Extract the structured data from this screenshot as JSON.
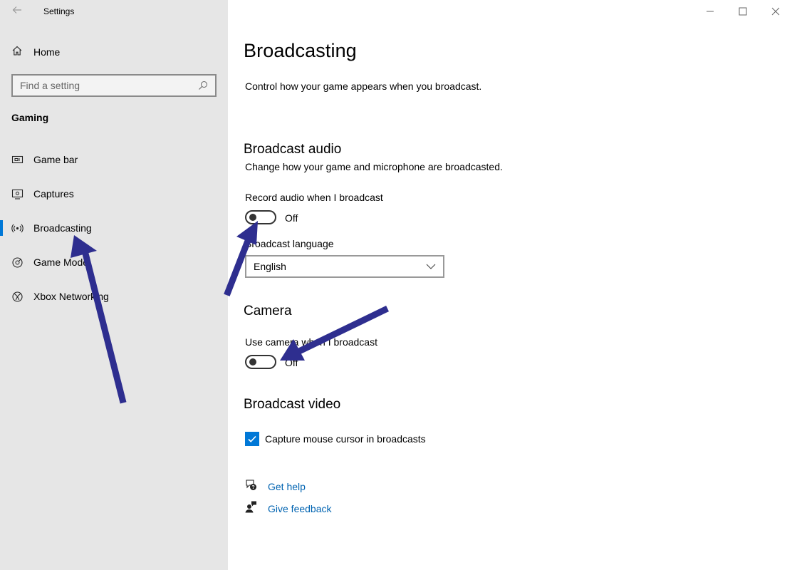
{
  "app": {
    "title": "Settings"
  },
  "sidebar": {
    "home_label": "Home",
    "search_placeholder": "Find a setting",
    "section_title": "Gaming",
    "items": [
      {
        "label": "Game bar",
        "icon": "game-bar-icon"
      },
      {
        "label": "Captures",
        "icon": "captures-icon"
      },
      {
        "label": "Broadcasting",
        "icon": "broadcasting-icon",
        "selected": true
      },
      {
        "label": "Game Mode",
        "icon": "game-mode-icon"
      },
      {
        "label": "Xbox Networking",
        "icon": "xbox-icon"
      }
    ]
  },
  "main": {
    "title": "Broadcasting",
    "description": "Control how your game appears when you broadcast.",
    "audio": {
      "heading": "Broadcast audio",
      "description": "Change how your game and microphone are broadcasted.",
      "record_label": "Record audio when I broadcast",
      "record_state": "Off",
      "language_label": "Broadcast language",
      "language_value": "English"
    },
    "camera": {
      "heading": "Camera",
      "use_label": "Use camera when I broadcast",
      "use_state": "Off"
    },
    "video": {
      "heading": "Broadcast video",
      "cursor_label": "Capture mouse cursor in broadcasts",
      "cursor_checked": true
    },
    "links": {
      "help": "Get help",
      "feedback": "Give feedback"
    }
  },
  "colors": {
    "accent": "#0078d7",
    "link": "#0063b1",
    "sidebar_bg": "#e6e6e6",
    "annotation_arrow": "#2e2e8f"
  }
}
